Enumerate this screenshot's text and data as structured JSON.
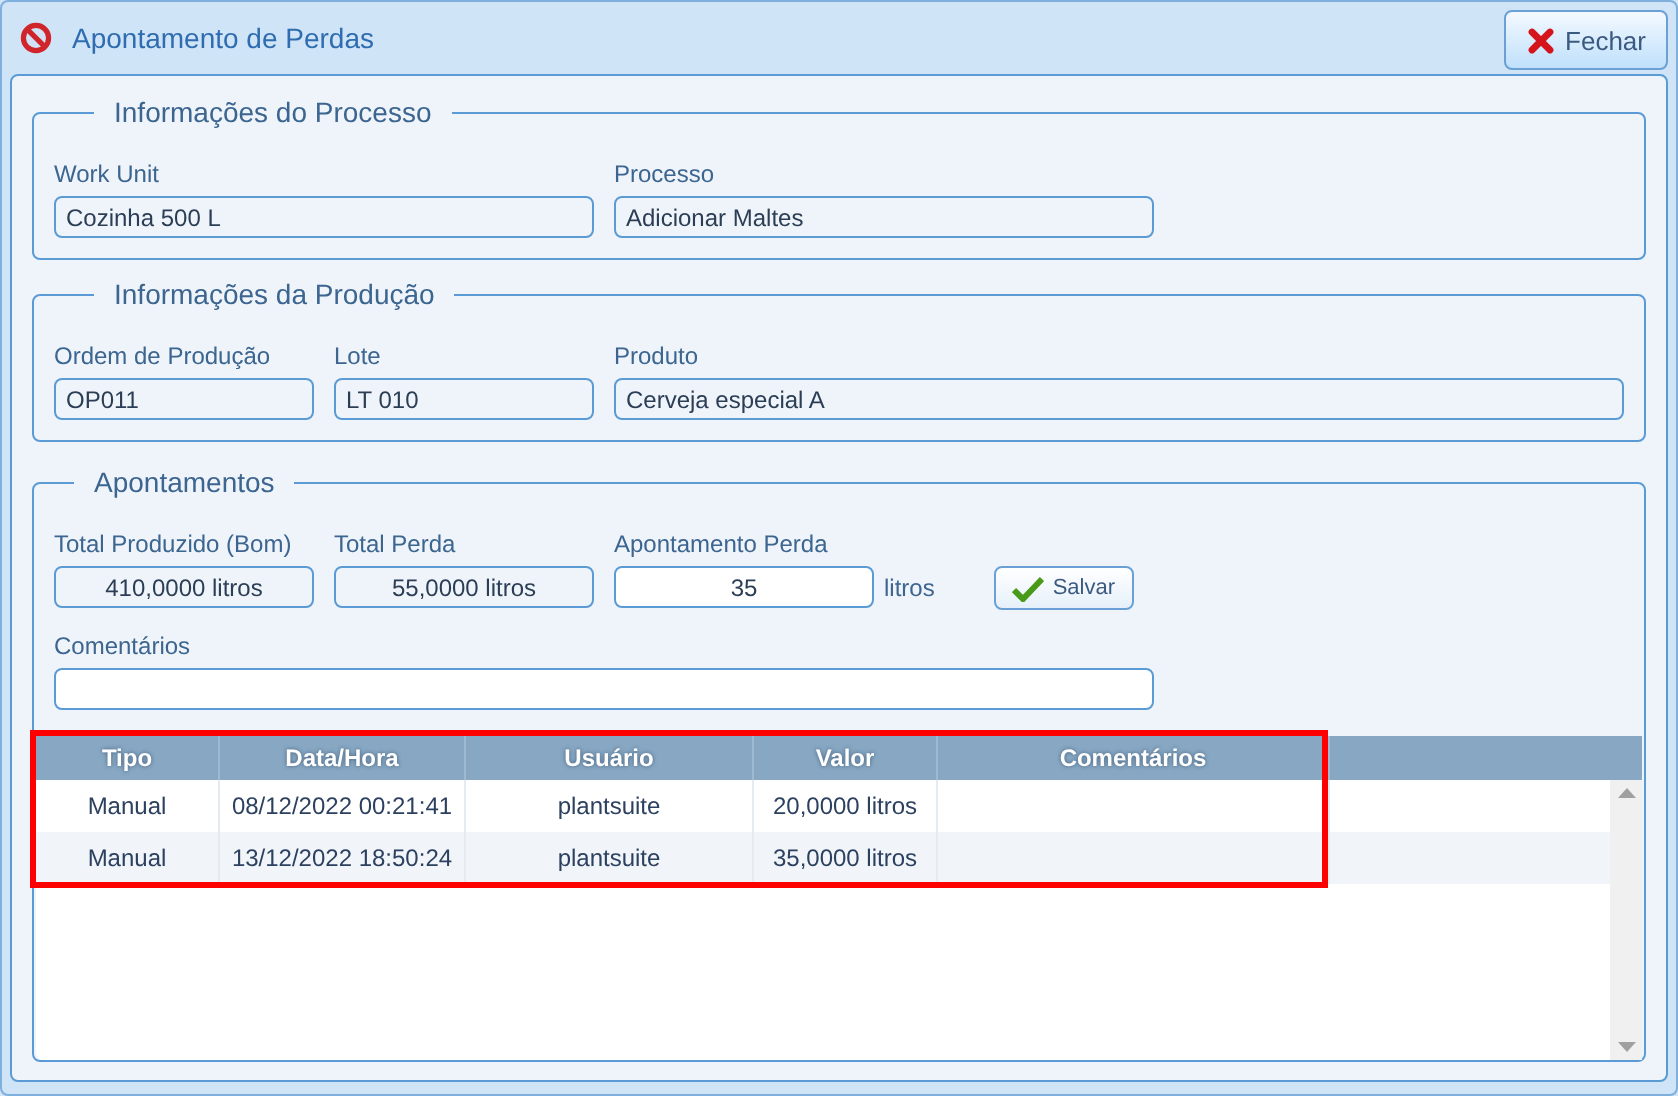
{
  "window": {
    "title": "Apontamento de Perdas",
    "close_button": "Fechar"
  },
  "groups": [
    {
      "title": "Informações do Processo",
      "rows": [
        [
          {
            "label": "Work Unit",
            "value": "Cozinha 500 L",
            "kind": "readonly"
          },
          {
            "label": "Processo",
            "value": "Adicionar Maltes",
            "kind": "readonly"
          }
        ]
      ]
    },
    {
      "title": "Informações da Produção",
      "rows": [
        [
          {
            "label": "Ordem de Produção",
            "value": "OP011",
            "kind": "readonly"
          },
          {
            "label": "Lote",
            "value": "LT 010",
            "kind": "readonly"
          },
          {
            "label": "Produto",
            "value": "Cerveja especial A",
            "kind": "readonly"
          }
        ]
      ]
    },
    {
      "title": "Apontamentos",
      "rows": [
        [
          {
            "label": "Total Produzido (Bom)",
            "value": "410,0000 litros",
            "kind": "readonly"
          },
          {
            "label": "Total Perda",
            "value": "55,0000 litros",
            "kind": "readonly"
          },
          {
            "label": "Apontamento Perda",
            "value": "35",
            "kind": "input",
            "unit": "litros"
          },
          {
            "kind": "button",
            "label": "Salvar"
          }
        ],
        [
          {
            "label": "Comentários",
            "kind": "input"
          }
        ]
      ],
      "table": {
        "highlighted": true,
        "columns": [
          "Tipo",
          "Data/Hora",
          "Usuário",
          "Valor",
          "Comentários"
        ],
        "rows": [
          [
            "Manual",
            "08/12/2022 00:21:41",
            "plantsuite",
            "20,0000 litros",
            ""
          ],
          [
            "Manual",
            "13/12/2022 18:50:24",
            "plantsuite",
            "35,0000 litros",
            ""
          ]
        ]
      }
    }
  ]
}
